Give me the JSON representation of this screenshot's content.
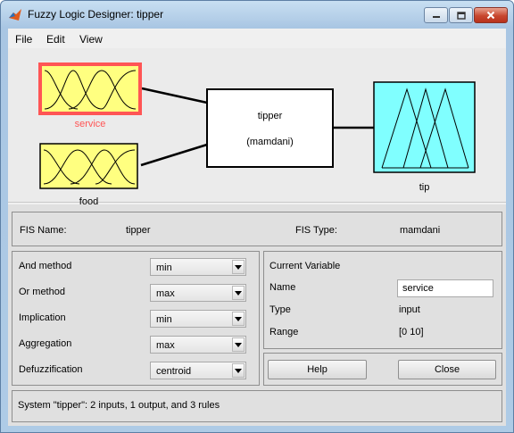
{
  "window": {
    "title": "Fuzzy Logic Designer: tipper",
    "controls": {
      "minimize_icon": "minimize-icon",
      "maximize_icon": "maximize-icon",
      "close_icon": "close-icon"
    }
  },
  "menu": {
    "items": [
      "File",
      "Edit",
      "View"
    ]
  },
  "diagram": {
    "inputs": [
      {
        "name": "service",
        "selected": true
      },
      {
        "name": "food",
        "selected": false
      }
    ],
    "system": {
      "name": "tipper",
      "type_label": "(mamdani)"
    },
    "output": {
      "name": "tip"
    },
    "colors": {
      "input_fill": "#ffff80",
      "output_fill": "#80ffff",
      "selected_border": "#ff5555",
      "selected_label": "#ff5555"
    }
  },
  "fis_info": {
    "name_label": "FIS Name:",
    "name_value": "tipper",
    "type_label": "FIS Type:",
    "type_value": "mamdani"
  },
  "methods": [
    {
      "label": "And method",
      "value": "min"
    },
    {
      "label": "Or method",
      "value": "max"
    },
    {
      "label": "Implication",
      "value": "min"
    },
    {
      "label": "Aggregation",
      "value": "max"
    },
    {
      "label": "Defuzzification",
      "value": "centroid"
    }
  ],
  "current_variable": {
    "title": "Current Variable",
    "name_label": "Name",
    "name_value": "service",
    "type_label": "Type",
    "type_value": "input",
    "range_label": "Range",
    "range_value": "[0 10]"
  },
  "buttons": {
    "help": "Help",
    "close": "Close"
  },
  "status": "System \"tipper\": 2 inputs, 1 output, and 3 rules"
}
